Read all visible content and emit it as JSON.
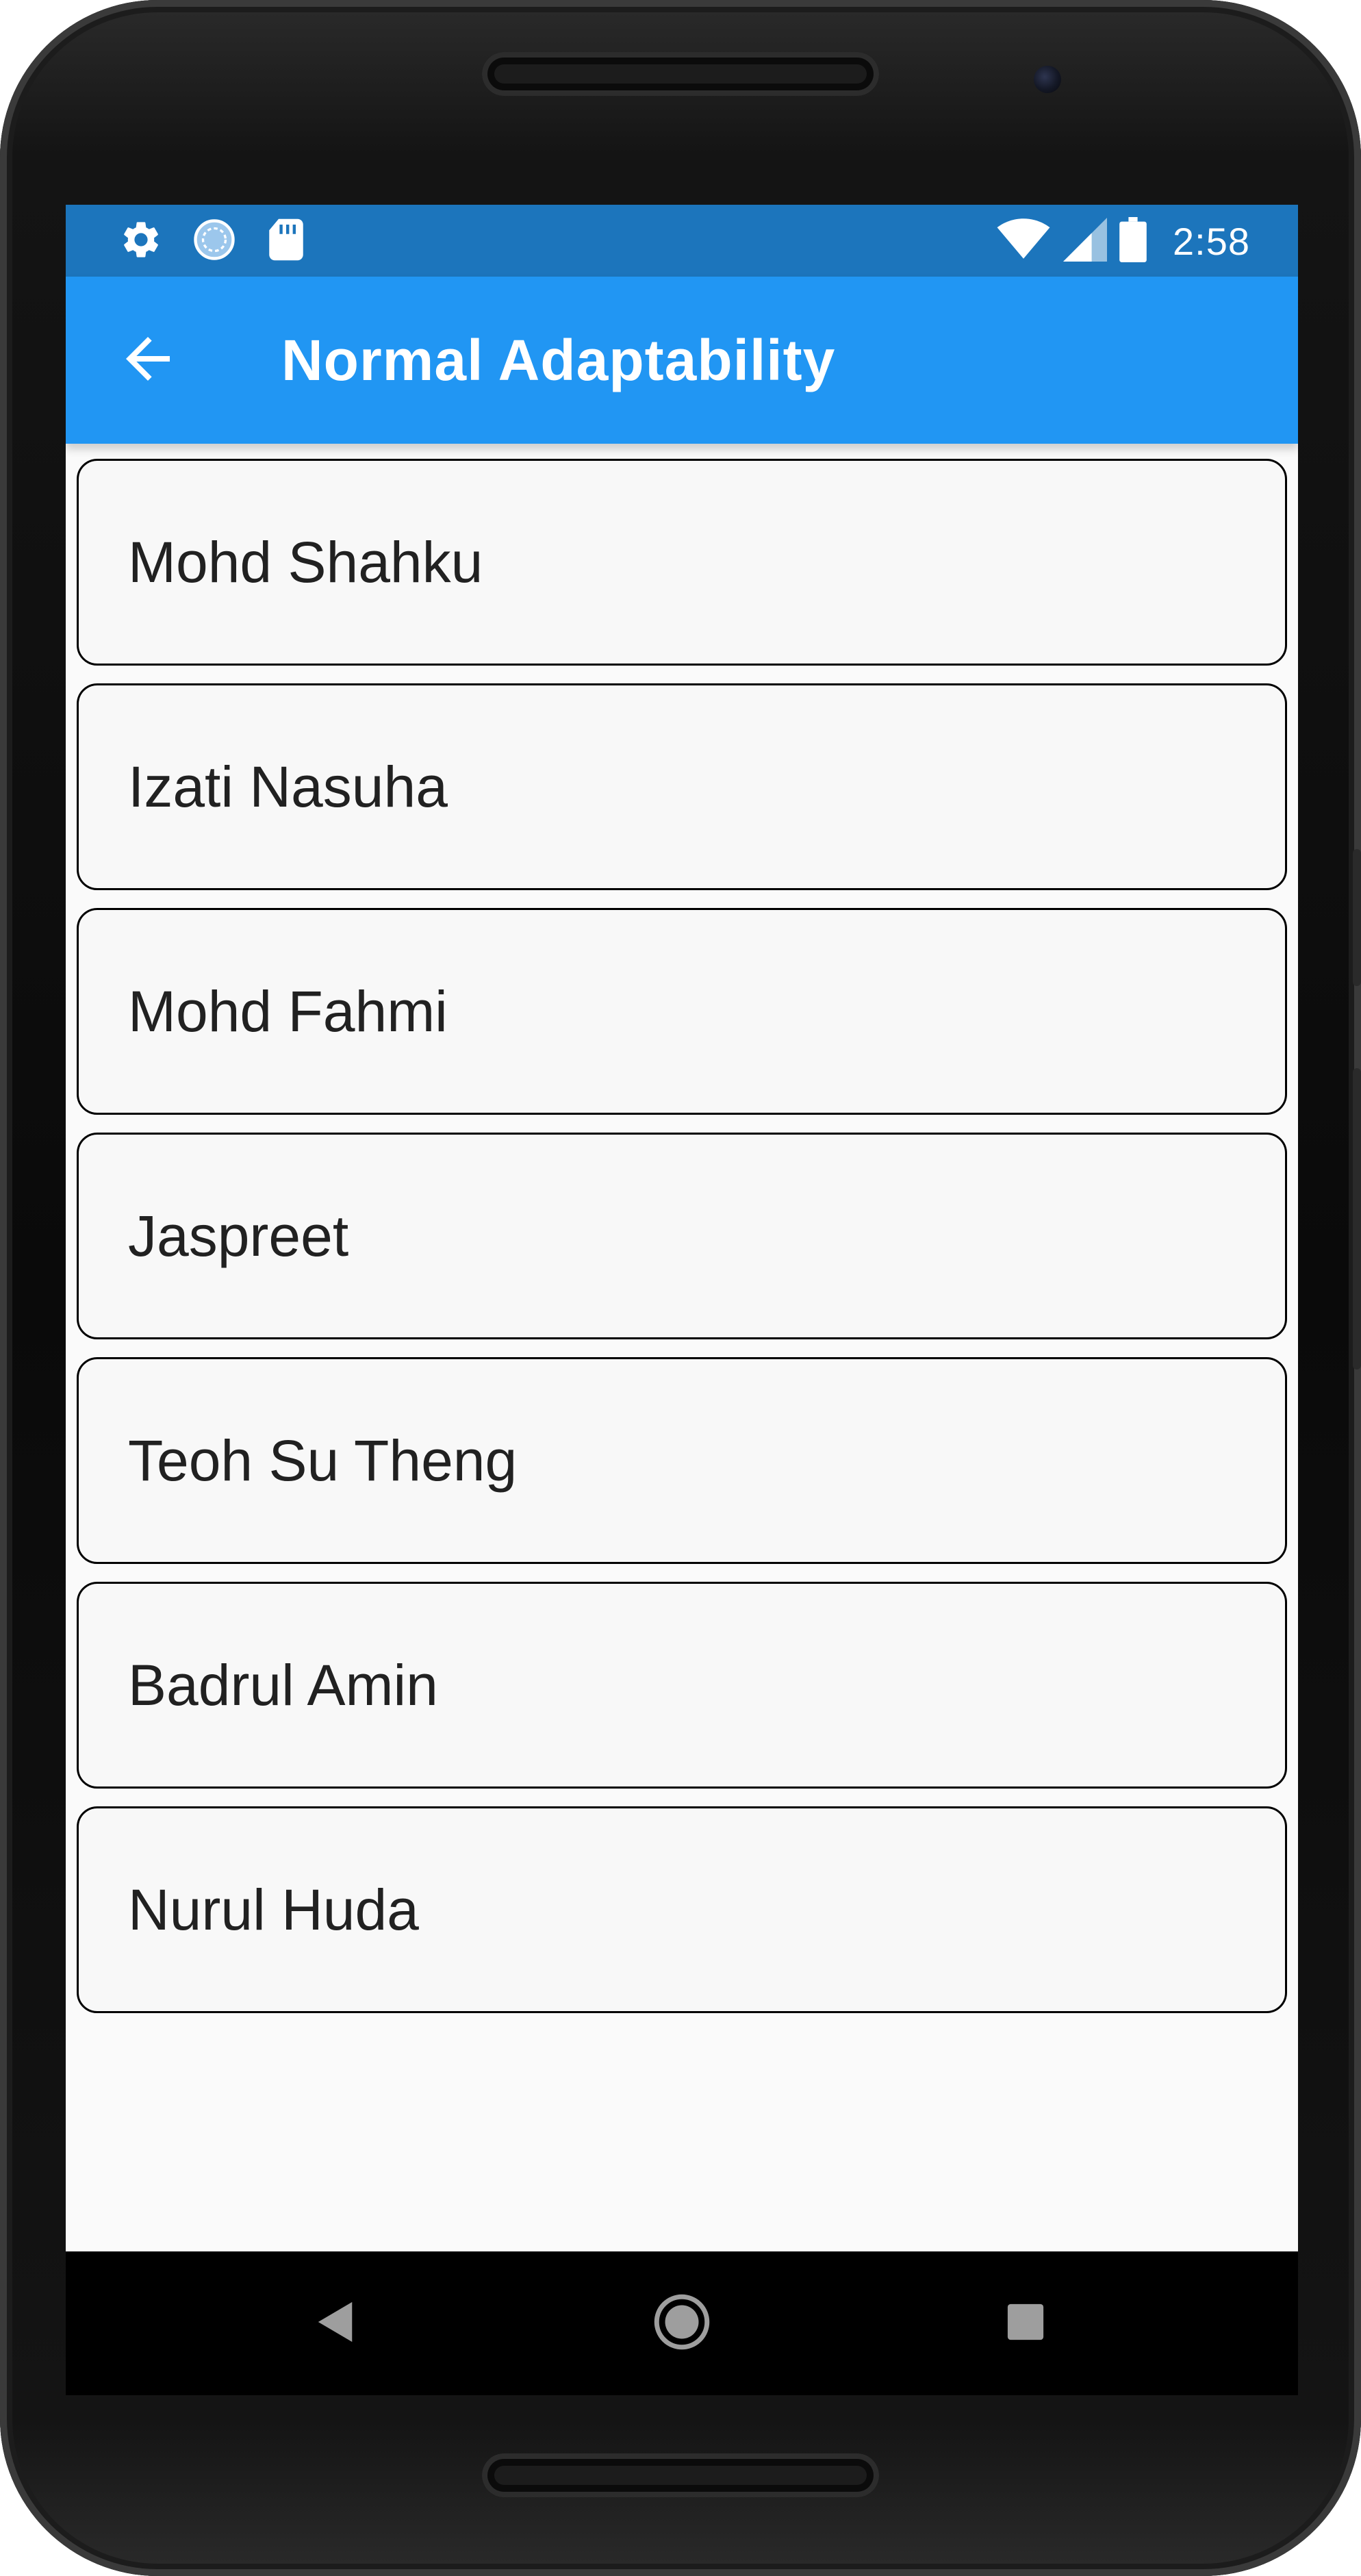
{
  "status_bar": {
    "time": "2:58",
    "left_icons": [
      "gear-icon",
      "sync-circle-icon",
      "sd-card-icon"
    ],
    "right_icons": [
      "wifi-icon",
      "cellular-signal-icon",
      "battery-icon"
    ],
    "background_color": "#1c75bc"
  },
  "app_bar": {
    "title": "Normal Adaptability",
    "back_icon": "arrow-left-icon",
    "background_color": "#2196f3"
  },
  "list": {
    "items": [
      {
        "label": "Mohd Shahku"
      },
      {
        "label": "Izati Nasuha"
      },
      {
        "label": "Mohd Fahmi"
      },
      {
        "label": "Jaspreet"
      },
      {
        "label": "Teoh Su Theng"
      },
      {
        "label": "Badrul Amin"
      },
      {
        "label": "Nurul Huda"
      }
    ]
  },
  "nav_bar": {
    "buttons": [
      "back-triangle-icon",
      "home-circle-icon",
      "recents-square-icon"
    ]
  }
}
